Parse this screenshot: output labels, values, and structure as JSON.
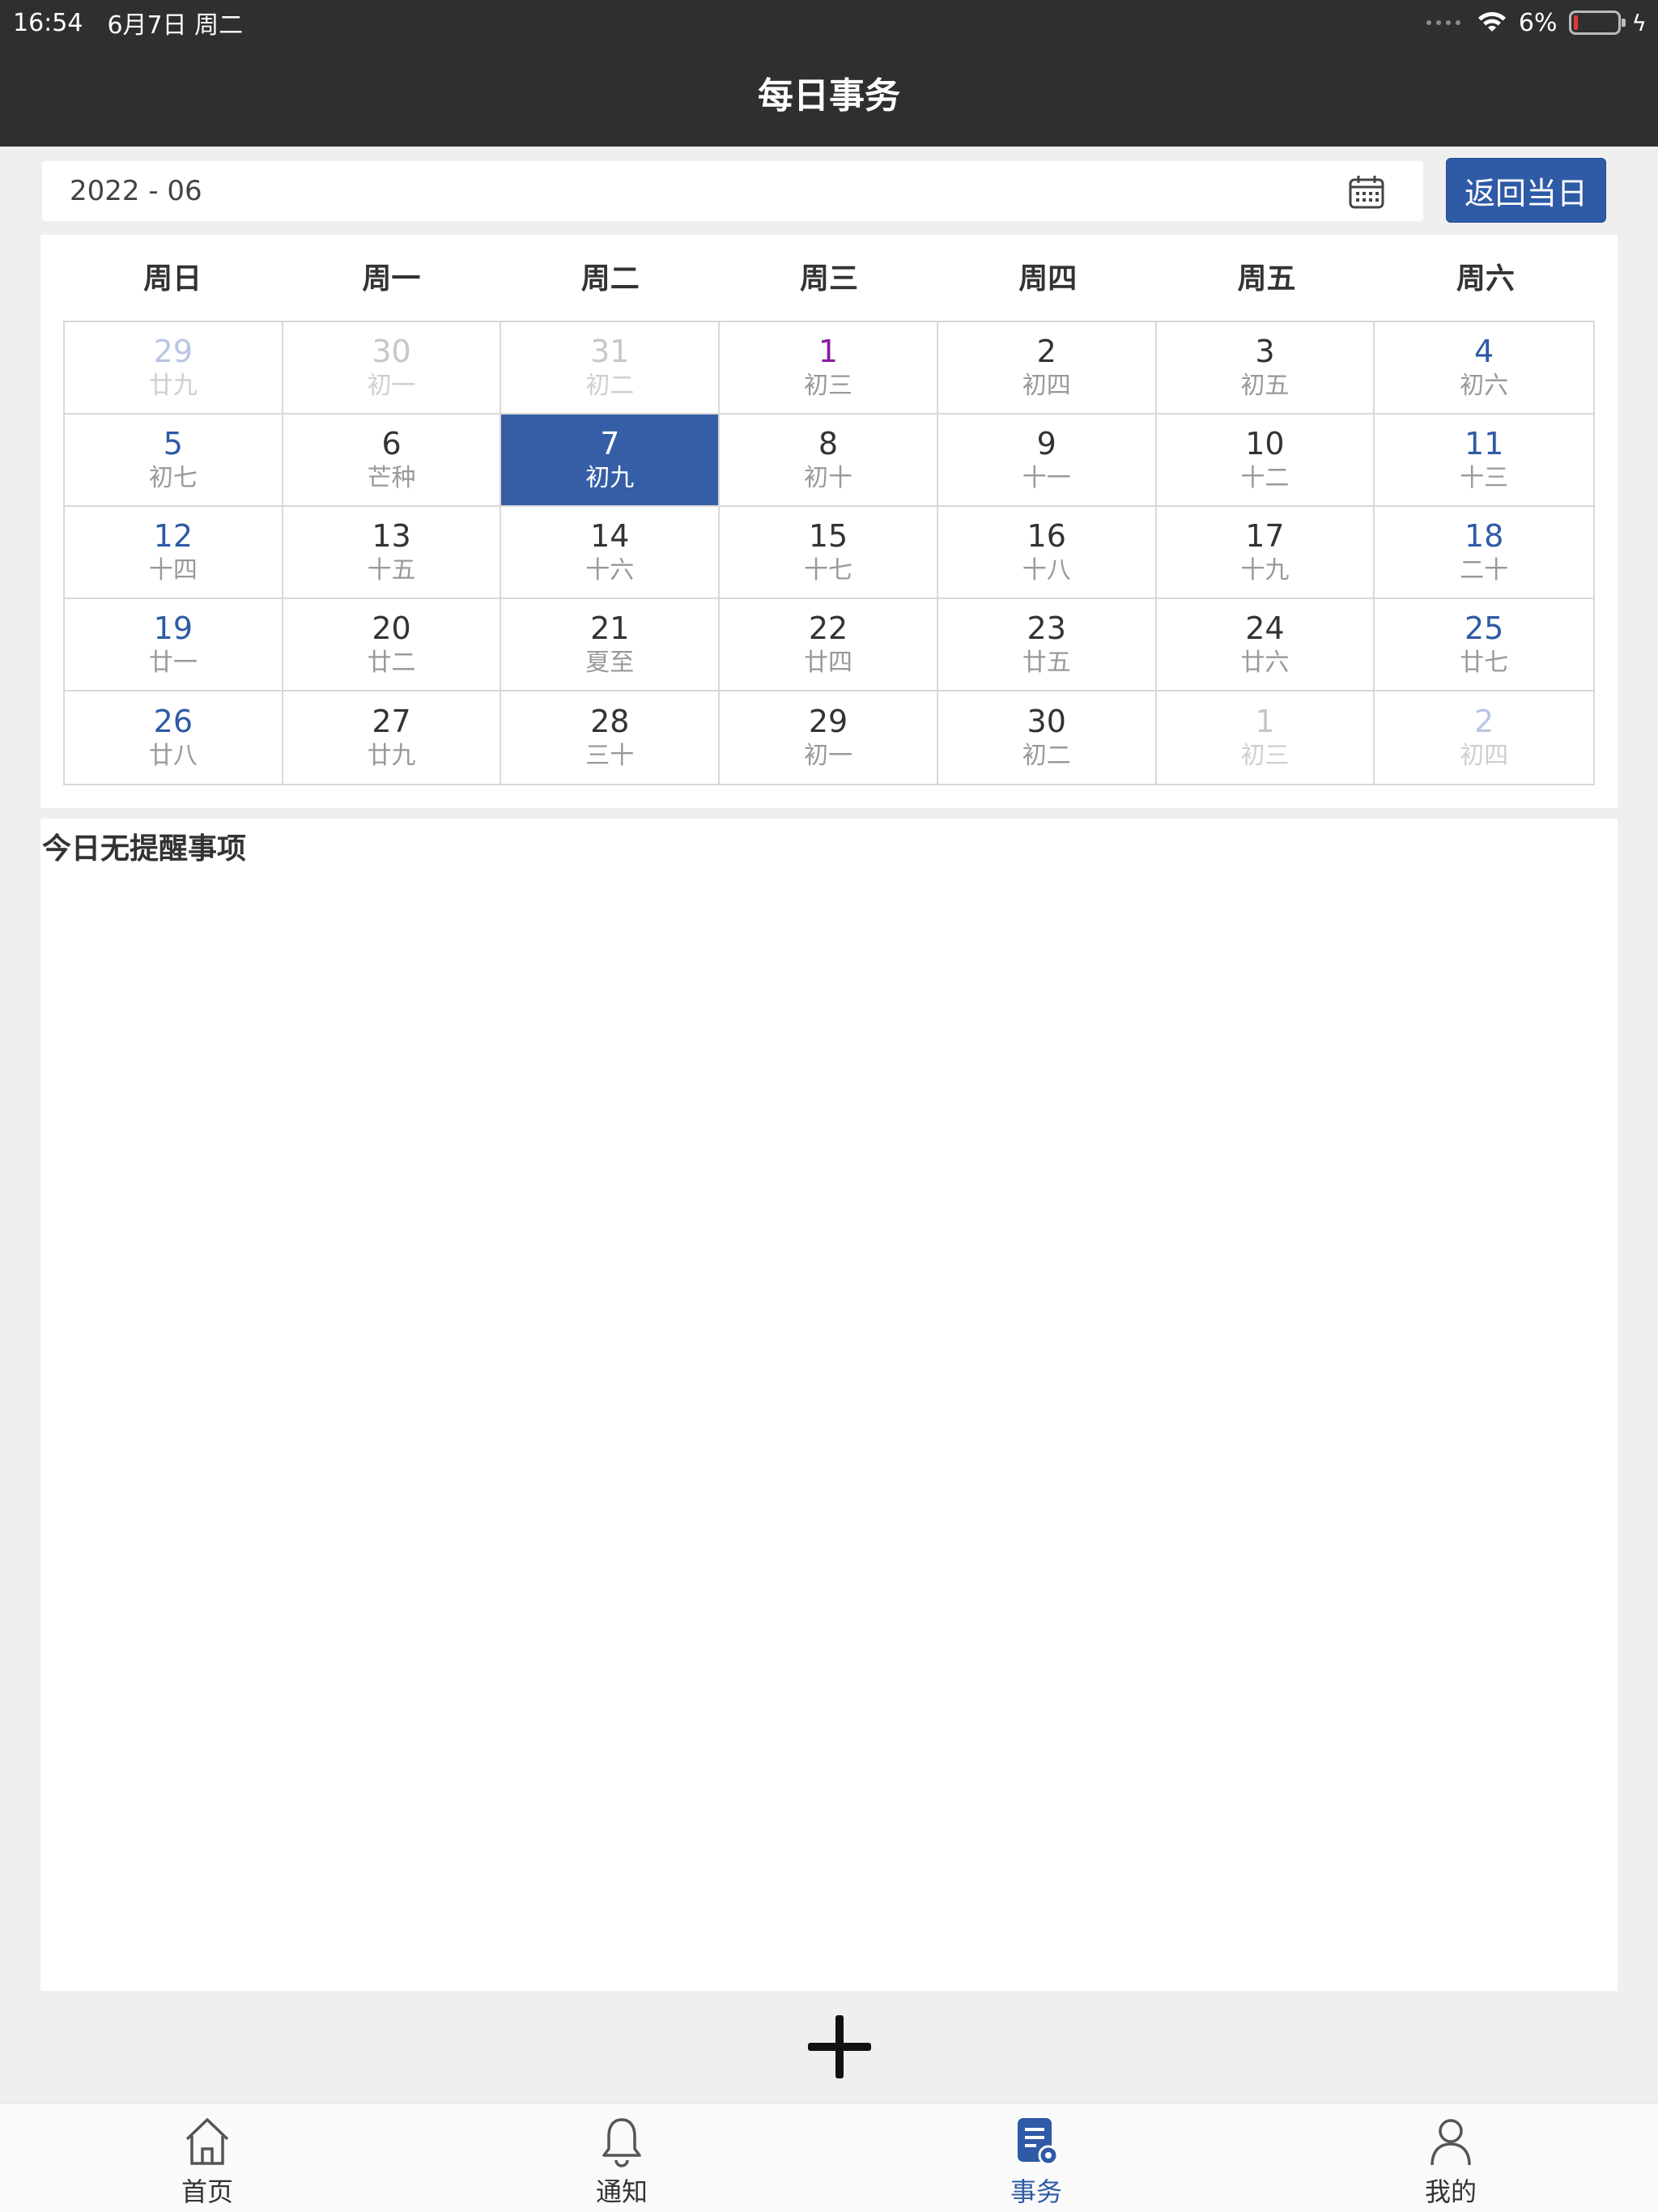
{
  "status_bar": {
    "time": "16:54",
    "date": "6月7日 周二",
    "battery": "6%"
  },
  "header": {
    "title": "每日事务"
  },
  "date_bar": {
    "value": "2022 - 06",
    "today_button": "返回当日"
  },
  "calendar": {
    "weekdays": [
      "周日",
      "周一",
      "周二",
      "周三",
      "周四",
      "周五",
      "周六"
    ],
    "days": [
      {
        "d": "29",
        "l": "廿九",
        "other": true
      },
      {
        "d": "30",
        "l": "初一",
        "other": true
      },
      {
        "d": "31",
        "l": "初二",
        "other": true
      },
      {
        "d": "1",
        "l": "初三",
        "first": true
      },
      {
        "d": "2",
        "l": "初四"
      },
      {
        "d": "3",
        "l": "初五"
      },
      {
        "d": "4",
        "l": "初六"
      },
      {
        "d": "5",
        "l": "初七"
      },
      {
        "d": "6",
        "l": "芒种"
      },
      {
        "d": "7",
        "l": "初九",
        "selected": true
      },
      {
        "d": "8",
        "l": "初十"
      },
      {
        "d": "9",
        "l": "十一"
      },
      {
        "d": "10",
        "l": "十二"
      },
      {
        "d": "11",
        "l": "十三"
      },
      {
        "d": "12",
        "l": "十四"
      },
      {
        "d": "13",
        "l": "十五"
      },
      {
        "d": "14",
        "l": "十六"
      },
      {
        "d": "15",
        "l": "十七"
      },
      {
        "d": "16",
        "l": "十八"
      },
      {
        "d": "17",
        "l": "十九"
      },
      {
        "d": "18",
        "l": "二十"
      },
      {
        "d": "19",
        "l": "廿一"
      },
      {
        "d": "20",
        "l": "廿二"
      },
      {
        "d": "21",
        "l": "夏至"
      },
      {
        "d": "22",
        "l": "廿四"
      },
      {
        "d": "23",
        "l": "廿五"
      },
      {
        "d": "24",
        "l": "廿六"
      },
      {
        "d": "25",
        "l": "廿七"
      },
      {
        "d": "26",
        "l": "廿八"
      },
      {
        "d": "27",
        "l": "廿九"
      },
      {
        "d": "28",
        "l": "三十"
      },
      {
        "d": "29",
        "l": "初一"
      },
      {
        "d": "30",
        "l": "初二"
      },
      {
        "d": "1",
        "l": "初三",
        "other": true
      },
      {
        "d": "2",
        "l": "初四",
        "other": true
      }
    ]
  },
  "reminders": {
    "empty_text": "今日无提醒事项"
  },
  "tabbar": {
    "items": [
      {
        "label": "首页",
        "icon": "home-icon"
      },
      {
        "label": "通知",
        "icon": "bell-icon"
      },
      {
        "label": "事务",
        "icon": "tasks-icon",
        "active": true
      },
      {
        "label": "我的",
        "icon": "user-icon"
      }
    ]
  },
  "colors": {
    "header_bg": "#2f2f2f",
    "accent": "#2e5aa6",
    "selected": "#365ea6"
  }
}
